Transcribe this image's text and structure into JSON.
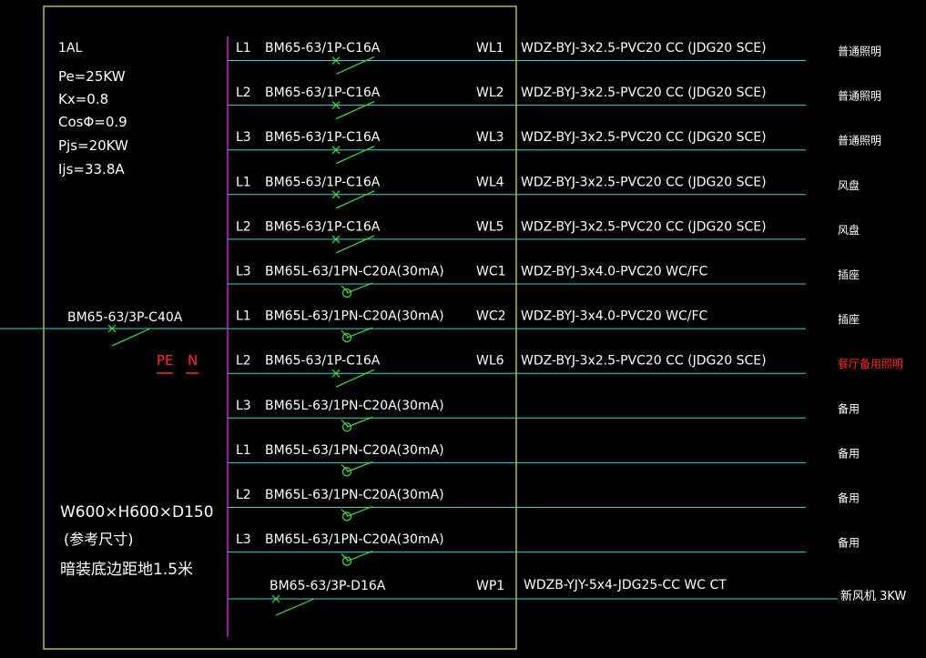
{
  "panel": {
    "name": "1AL",
    "params": [
      "Pe=25KW",
      "Kx=0.8",
      "CosΦ=0.9",
      "Pjs=20KW",
      "Ijs=33.8A"
    ],
    "size": "W600×H600×D150",
    "size_note": "(参考尺寸)",
    "install": "暗装底边距地1.5米",
    "main_breaker": "BM65-63/3P-C40A",
    "pe_label": "PE",
    "n_label": "N"
  },
  "colors": {
    "frame": "#e6e64c",
    "busbar": "#d21bd2",
    "line": "#2fd3d3",
    "breaker": "#3fe03f",
    "text": "#ffffff",
    "highlight": "#ff2a2a"
  },
  "circuits": [
    {
      "phase": "L1",
      "breaker": "BM65-63/1P-C16A",
      "id": "WL1",
      "cable": "WDZ-BYJ-3x2.5-PVC20  CC (JDG20  SCE)",
      "load": "普通照明",
      "rcd": false,
      "highlight": false
    },
    {
      "phase": "L2",
      "breaker": "BM65-63/1P-C16A",
      "id": "WL2",
      "cable": "WDZ-BYJ-3x2.5-PVC20  CC (JDG20  SCE)",
      "load": "普通照明",
      "rcd": false,
      "highlight": false
    },
    {
      "phase": "L3",
      "breaker": "BM65-63/1P-C16A",
      "id": "WL3",
      "cable": "WDZ-BYJ-3x2.5-PVC20  CC (JDG20  SCE)",
      "load": "普通照明",
      "rcd": false,
      "highlight": false
    },
    {
      "phase": "L1",
      "breaker": "BM65-63/1P-C16A",
      "id": "WL4",
      "cable": "WDZ-BYJ-3x2.5-PVC20  CC (JDG20  SCE)",
      "load": "风盘",
      "rcd": false,
      "highlight": false
    },
    {
      "phase": "L2",
      "breaker": "BM65-63/1P-C16A",
      "id": "WL5",
      "cable": "WDZ-BYJ-3x2.5-PVC20  CC (JDG20  SCE)",
      "load": "风盘",
      "rcd": false,
      "highlight": false
    },
    {
      "phase": "L3",
      "breaker": "BM65L-63/1PN-C20A(30mA)",
      "id": "WC1",
      "cable": "WDZ-BYJ-3x4.0-PVC20  WC/FC",
      "load": "插座",
      "rcd": true,
      "highlight": false
    },
    {
      "phase": "L1",
      "breaker": "BM65L-63/1PN-C20A(30mA)",
      "id": "WC2",
      "cable": "WDZ-BYJ-3x4.0-PVC20  WC/FC",
      "load": "插座",
      "rcd": true,
      "highlight": false
    },
    {
      "phase": "L2",
      "breaker": "BM65-63/1P-C16A",
      "id": "WL6",
      "cable": "WDZ-BYJ-3x2.5-PVC20  CC (JDG20  SCE)",
      "load": "餐厅备用照明",
      "rcd": false,
      "highlight": true
    },
    {
      "phase": "L3",
      "breaker": "BM65L-63/1PN-C20A(30mA)",
      "id": "",
      "cable": "",
      "load": "备用",
      "rcd": true,
      "highlight": false
    },
    {
      "phase": "L1",
      "breaker": "BM65L-63/1PN-C20A(30mA)",
      "id": "",
      "cable": "",
      "load": "备用",
      "rcd": true,
      "highlight": false
    },
    {
      "phase": "L2",
      "breaker": "BM65L-63/1PN-C20A(30mA)",
      "id": "",
      "cable": "",
      "load": "备用",
      "rcd": true,
      "highlight": false
    },
    {
      "phase": "L3",
      "breaker": "BM65L-63/1PN-C20A(30mA)",
      "id": "",
      "cable": "",
      "load": "备用",
      "rcd": true,
      "highlight": false
    }
  ],
  "fan_circuit": {
    "breaker": "BM65-63/3P-D16A",
    "id": "WP1",
    "cable": "WDZB-YJY-5x4-JDG25-CC WC CT",
    "load": "新风机 3KW"
  }
}
